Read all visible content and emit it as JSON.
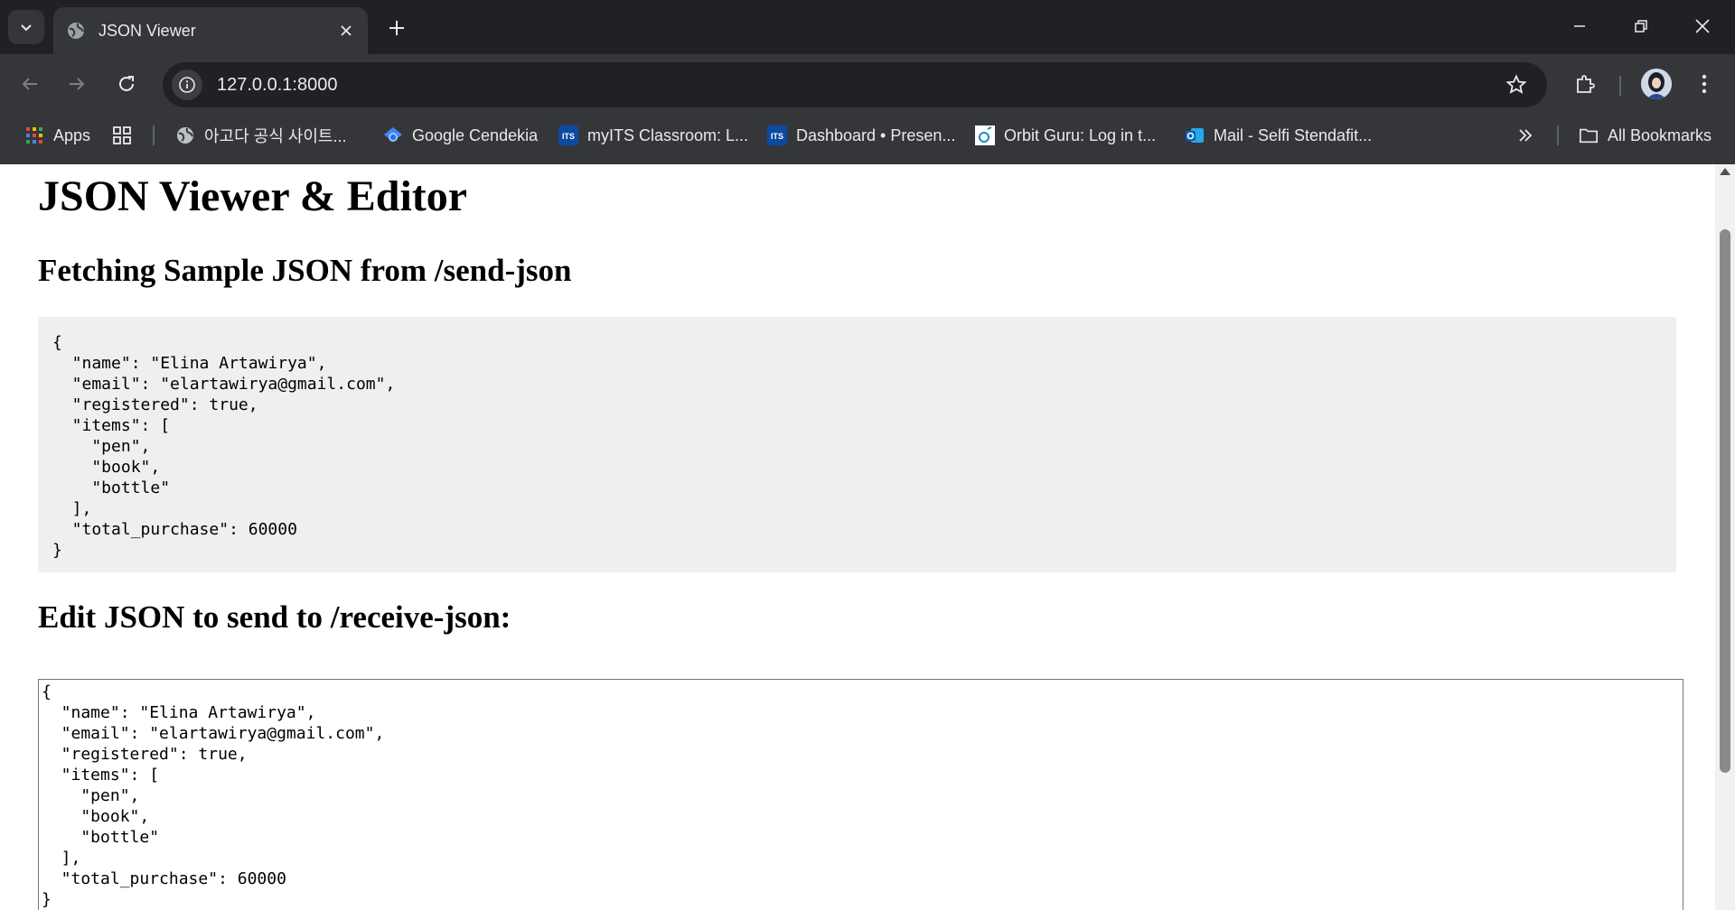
{
  "browser": {
    "tab_title": "JSON Viewer",
    "url": "127.0.0.1:8000"
  },
  "bookmarks": [
    {
      "label": "Apps",
      "icon": "apps-grid-icon"
    },
    {
      "label": "",
      "icon": "tab-groups-icon"
    },
    {
      "label": "아고다 공식 사이트...",
      "icon": "globe-icon"
    },
    {
      "label": "Google Cendekia",
      "icon": "google-scholar-icon"
    },
    {
      "label": "myITS Classroom: L...",
      "icon": "its-logo-icon"
    },
    {
      "label": "Dashboard • Presen...",
      "icon": "its-logo-icon"
    },
    {
      "label": "Orbit Guru: Log in t...",
      "icon": "orbit-icon"
    },
    {
      "label": "Mail - Selfi Stendafit...",
      "icon": "outlook-icon"
    }
  ],
  "all_bookmarks_label": "All Bookmarks",
  "page": {
    "title": "JSON Viewer & Editor",
    "fetch_heading": "Fetching Sample JSON from /send-json",
    "fetched_json": "{\n  \"name\": \"Elina Artawirya\",\n  \"email\": \"elartawirya@gmail.com\",\n  \"registered\": true,\n  \"items\": [\n    \"pen\",\n    \"book\",\n    \"bottle\"\n  ],\n  \"total_purchase\": 60000\n}",
    "edit_heading": "Edit JSON to send to /receive-json:",
    "editor_json": "{\n  \"name\": \"Elina Artawirya\",\n  \"email\": \"elartawirya@gmail.com\",\n  \"registered\": true,\n  \"items\": [\n    \"pen\",\n    \"book\",\n    \"bottle\"\n  ],\n  \"total_purchase\": 60000\n}"
  },
  "colors": {
    "chrome_dark": "#202124",
    "chrome_toolbar": "#35363a",
    "code_bg": "#efefef"
  }
}
